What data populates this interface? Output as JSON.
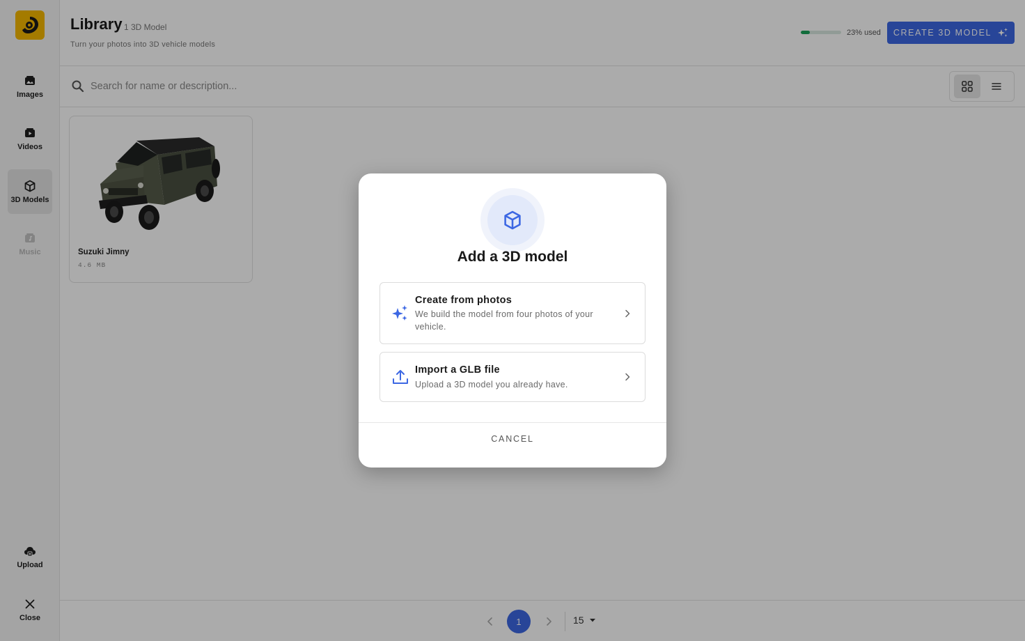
{
  "sidebar": {
    "logo_icon": "app-logo",
    "items": [
      {
        "label": "Images",
        "icon": "images-icon"
      },
      {
        "label": "Videos",
        "icon": "videos-icon"
      },
      {
        "label": "3D Models",
        "icon": "cube-icon",
        "active": true
      },
      {
        "label": "Music",
        "icon": "music-icon",
        "disabled": true
      }
    ],
    "bottom": [
      {
        "label": "Upload",
        "icon": "upload-cloud-icon"
      },
      {
        "label": "Close",
        "icon": "close-icon"
      }
    ]
  },
  "header": {
    "title": "Library",
    "count": "1 3D Model",
    "subtitle": "Turn your photos into 3D vehicle models",
    "usage_fraction": 0.23,
    "usage_text": "23% used",
    "create_button": "CREATE 3D MODEL"
  },
  "search": {
    "placeholder": "Search for name or description..."
  },
  "view_toggle": {
    "active": "grid"
  },
  "models": [
    {
      "name": "Suzuki Jimny",
      "size": "4.6 MB"
    }
  ],
  "pagination": {
    "current_page": "1",
    "page_size": "15"
  },
  "modal": {
    "title": "Add a 3D model",
    "options": [
      {
        "title": "Create from photos",
        "description": "We build the model from four photos of your vehicle.",
        "icon": "sparkles-icon"
      },
      {
        "title": "Import a GLB file",
        "description": "Upload a 3D model you already have.",
        "icon": "upload-icon"
      }
    ],
    "cancel": "CANCEL"
  },
  "colors": {
    "accent": "#3c67e3",
    "usage_fill": "#1ba35a",
    "logo": "#f5b800"
  }
}
